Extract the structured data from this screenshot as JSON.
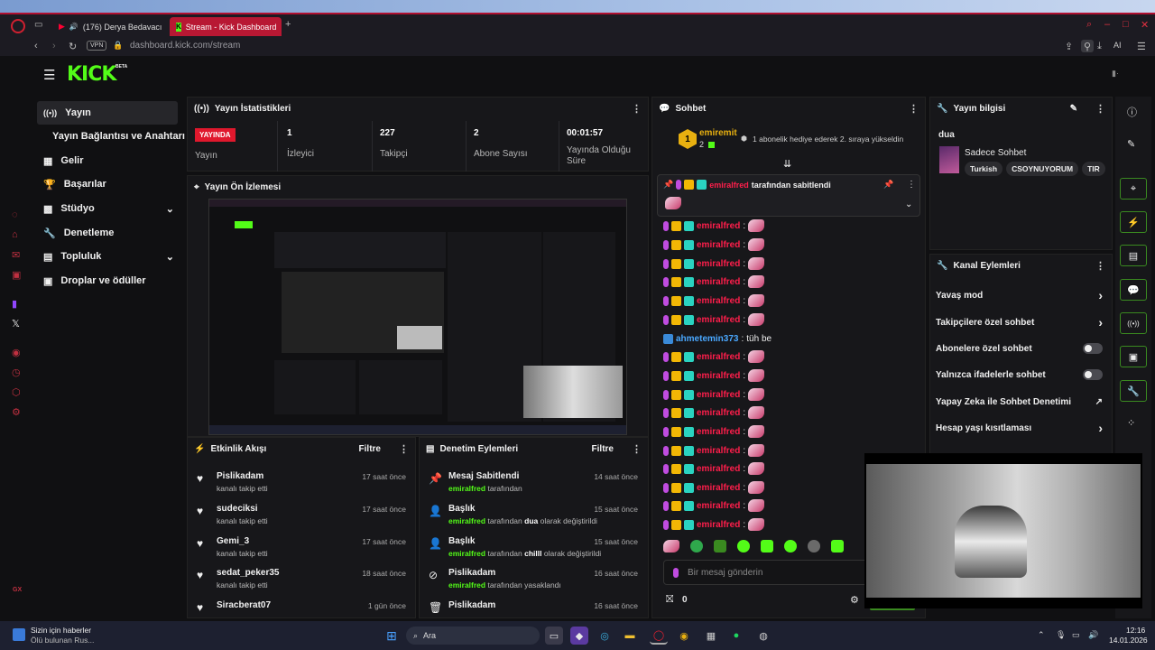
{
  "browser": {
    "tabs": [
      {
        "label": "(176) Derya Bedavacı"
      },
      {
        "label": "Stream - Kick Dashboard"
      }
    ],
    "url": "dashboard.kick.com/stream",
    "vpn": "VPN",
    "ai_label": "AI"
  },
  "brand": {
    "logo": "KICK",
    "beta": "BETA"
  },
  "nav": {
    "items": [
      {
        "label": "Yayın"
      },
      {
        "label": "Yayın Bağlantısı ve Anahtarı"
      },
      {
        "label": "Gelir"
      },
      {
        "label": "Başarılar"
      },
      {
        "label": "Stüdyo"
      },
      {
        "label": "Denetleme"
      },
      {
        "label": "Topluluk"
      },
      {
        "label": "Droplar ve ödüller"
      }
    ]
  },
  "stats": {
    "title": "Yayın İstatistikleri",
    "live_badge": "YAYINDA",
    "live_label": "Yayın",
    "viewers": {
      "value": "1",
      "label": "İzleyici"
    },
    "followers": {
      "value": "227",
      "label": "Takipçi"
    },
    "subs": {
      "value": "2",
      "label": "Abone Sayısı"
    },
    "uptime": {
      "value": "00:01:57",
      "label": "Yayında Olduğu Süre"
    }
  },
  "preview": {
    "title": "Yayın Ön İzlemesi"
  },
  "activity": {
    "title": "Etkinlik Akışı",
    "filter": "Filtre",
    "items": [
      {
        "name": "Pislikadam",
        "sub": "kanalı takip etti",
        "time": "17 saat önce"
      },
      {
        "name": "sudeciksi",
        "sub": "kanalı takip etti",
        "time": "17 saat önce"
      },
      {
        "name": "Gemi_3",
        "sub": "kanalı takip etti",
        "time": "17 saat önce"
      },
      {
        "name": "sedat_peker35",
        "sub": "kanalı takip etti",
        "time": "18 saat önce"
      },
      {
        "name": "Siracberat07",
        "sub": "",
        "time": "1 gün önce"
      }
    ]
  },
  "moderation": {
    "title": "Denetim Eylemleri",
    "filter": "Filtre",
    "items": [
      {
        "title": "Mesaj Sabitlendi",
        "user": "emiralfred",
        "rest": "tarafından",
        "time": "14 saat önce"
      },
      {
        "title": "Başlık",
        "user": "emiralfred",
        "rest": "tarafından",
        "bold": "dua",
        "rest2": "olarak değiştirildi",
        "time": "15 saat önce"
      },
      {
        "title": "Başlık",
        "user": "emiralfred",
        "rest": "tarafından",
        "bold": "chilll",
        "rest2": "olarak değiştirildi",
        "time": "15 saat önce"
      },
      {
        "title": "Pislikadam",
        "user": "emiralfred",
        "rest": "tarafından yasaklandı",
        "time": "16 saat önce"
      },
      {
        "title": "Pislikadam",
        "user": "",
        "rest": "",
        "time": "16 saat önce"
      }
    ]
  },
  "chat": {
    "title": "Sohbet",
    "top_user": "emiremit",
    "top_count": "2",
    "gift_note": "1 abonelik hediye ederek 2. sıraya yükseldin",
    "pinned_by": "emiralfred",
    "pinned_text": "tarafından sabitlendi",
    "user": "emiralfred",
    "other_user": "ahmetemin373",
    "other_msg": "tüh be",
    "placeholder": "Bir mesaj gönderin",
    "points": "0"
  },
  "info": {
    "title": "Yayın bilgisi",
    "stream_title": "dua",
    "category": "Sadece Sohbet",
    "tags": [
      "Turkish",
      "CSOYNUYORUM",
      "TIR"
    ]
  },
  "channel": {
    "title": "Kanal Eylemleri",
    "items": [
      {
        "label": "Yavaş mod"
      },
      {
        "label": "Takipçilere özel sohbet"
      },
      {
        "label": "Abonelere özel sohbet"
      },
      {
        "label": "Yalnızca ifadelerle sohbet"
      },
      {
        "label": "Yapay Zeka ile Sohbet Denetimi"
      },
      {
        "label": "Hesap yaşı kısıtlaması"
      }
    ]
  },
  "taskbar": {
    "news_title": "Sizin için haberler",
    "news_sub": "Ölü bulunan Rus...",
    "search": "Ara",
    "time": "12:16",
    "date": "14.01.2026"
  },
  "colors": {
    "accent": "#53fc18",
    "opera_red": "#b81833",
    "live": "#e0182d"
  }
}
